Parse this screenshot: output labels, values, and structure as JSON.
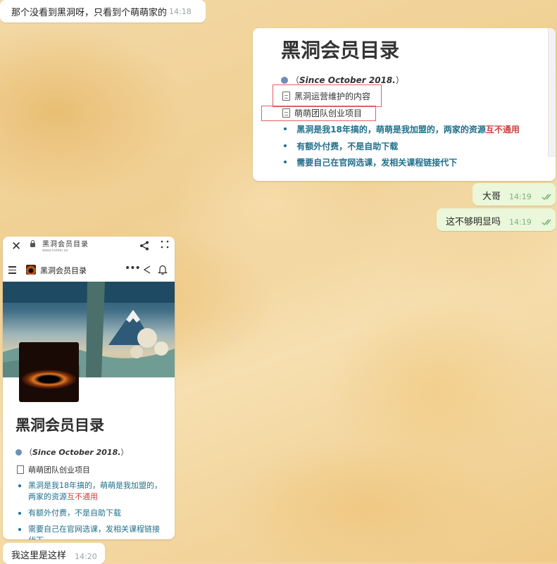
{
  "messages": [
    {
      "text": "那个没看到黑洞呀，只看到个萌萌家的",
      "time": "14:18"
    },
    {
      "text": "大哥",
      "time": "14:19"
    },
    {
      "text": "这不够明显吗",
      "time": "14:19"
    },
    {
      "text": "我这里是这样",
      "time": "14:20"
    }
  ],
  "image1": {
    "title": "黑洞会员目录",
    "since": "Since October 2018.",
    "doc1": "黑洞运营维护的内容",
    "doc2": "萌萌团队创业项目",
    "bullet1_a": "黑洞是我18年搞的，萌萌是我加盟的，两家的资源",
    "bullet1_red": "互不通用",
    "bullet2": "有额外付费，不是自助下载",
    "bullet3": "需要自己在官网选课，发相关课程链接代下"
  },
  "image2": {
    "browser_title": "黑洞会员目录",
    "url": "www.notion.so",
    "page_title": "黑洞会员目录",
    "h1": "黑洞会员目录",
    "since": "Since October 2018.",
    "doc": "萌萌团队创业项目",
    "bullet1_a": "黑洞是我",
    "bullet1_b": "18年搞的，萌萌是我加盟的，两家的资源",
    "bullet1_red": "互不通用",
    "bullet2": "有额外付费，不是自助下载",
    "bullet3": "需要自己在官网选课，发相关课程链接代下"
  },
  "colors": {
    "accent_blue": "#1f6f8b",
    "highlight_red": "#d04040",
    "outgoing_bubble": "#eaf7da",
    "incoming_bubble": "#ffffff"
  }
}
